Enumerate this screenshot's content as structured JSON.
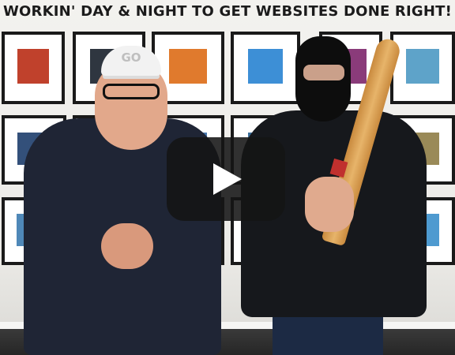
{
  "video": {
    "wall_text": "WORKIN' DAY & NIGHT TO GET WEBSITES DONE RIGHT!",
    "cap_text": "GO",
    "play_icon": "play-icon"
  }
}
